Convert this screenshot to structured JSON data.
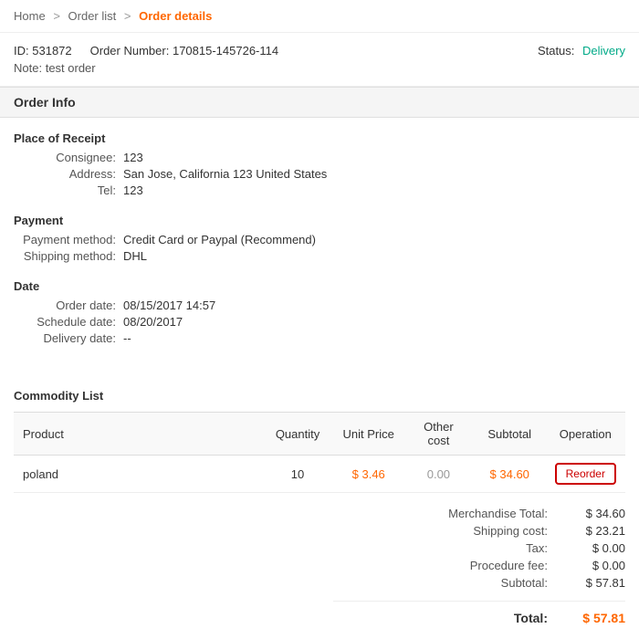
{
  "breadcrumb": {
    "home": "Home",
    "order_list": "Order list",
    "current": "Order details"
  },
  "order": {
    "id_label": "ID:",
    "id_value": "531872",
    "order_number_label": "Order Number:",
    "order_number_value": "170815-145726-114",
    "note_label": "Note:",
    "note_value": "test order",
    "status_label": "Status:",
    "status_value": "Delivery"
  },
  "section_title": "Order Info",
  "place_of_receipt": {
    "title": "Place of Receipt",
    "consignee_label": "Consignee:",
    "consignee_value": "123",
    "address_label": "Address:",
    "address_value": "San Jose, California 123 United States",
    "tel_label": "Tel:",
    "tel_value": "123"
  },
  "payment": {
    "title": "Payment",
    "method_label": "Payment method:",
    "method_value": "Credit Card or Paypal (Recommend)",
    "shipping_label": "Shipping method:",
    "shipping_value": "DHL"
  },
  "date": {
    "title": "Date",
    "order_date_label": "Order date:",
    "order_date_value": "08/15/2017 14:57",
    "schedule_date_label": "Schedule date:",
    "schedule_date_value": "08/20/2017",
    "delivery_date_label": "Delivery date:",
    "delivery_date_value": "--"
  },
  "commodity": {
    "title": "Commodity List",
    "columns": {
      "product": "Product",
      "quantity": "Quantity",
      "unit_price": "Unit Price",
      "other_cost": "Other cost",
      "subtotal": "Subtotal",
      "operation": "Operation"
    },
    "rows": [
      {
        "product": "poland",
        "quantity": "10",
        "unit_price": "$ 3.46",
        "other_cost": "0.00",
        "subtotal": "$ 34.60",
        "operation": "Reorder"
      }
    ]
  },
  "totals": {
    "merchandise_label": "Merchandise Total:",
    "merchandise_value": "$ 34.60",
    "shipping_label": "Shipping cost:",
    "shipping_value": "$ 23.21",
    "tax_label": "Tax:",
    "tax_value": "$ 0.00",
    "procedure_label": "Procedure fee:",
    "procedure_value": "$ 0.00",
    "subtotal_label": "Subtotal:",
    "subtotal_value": "$ 57.81",
    "total_label": "Total:",
    "total_value": "$ 57.81"
  }
}
